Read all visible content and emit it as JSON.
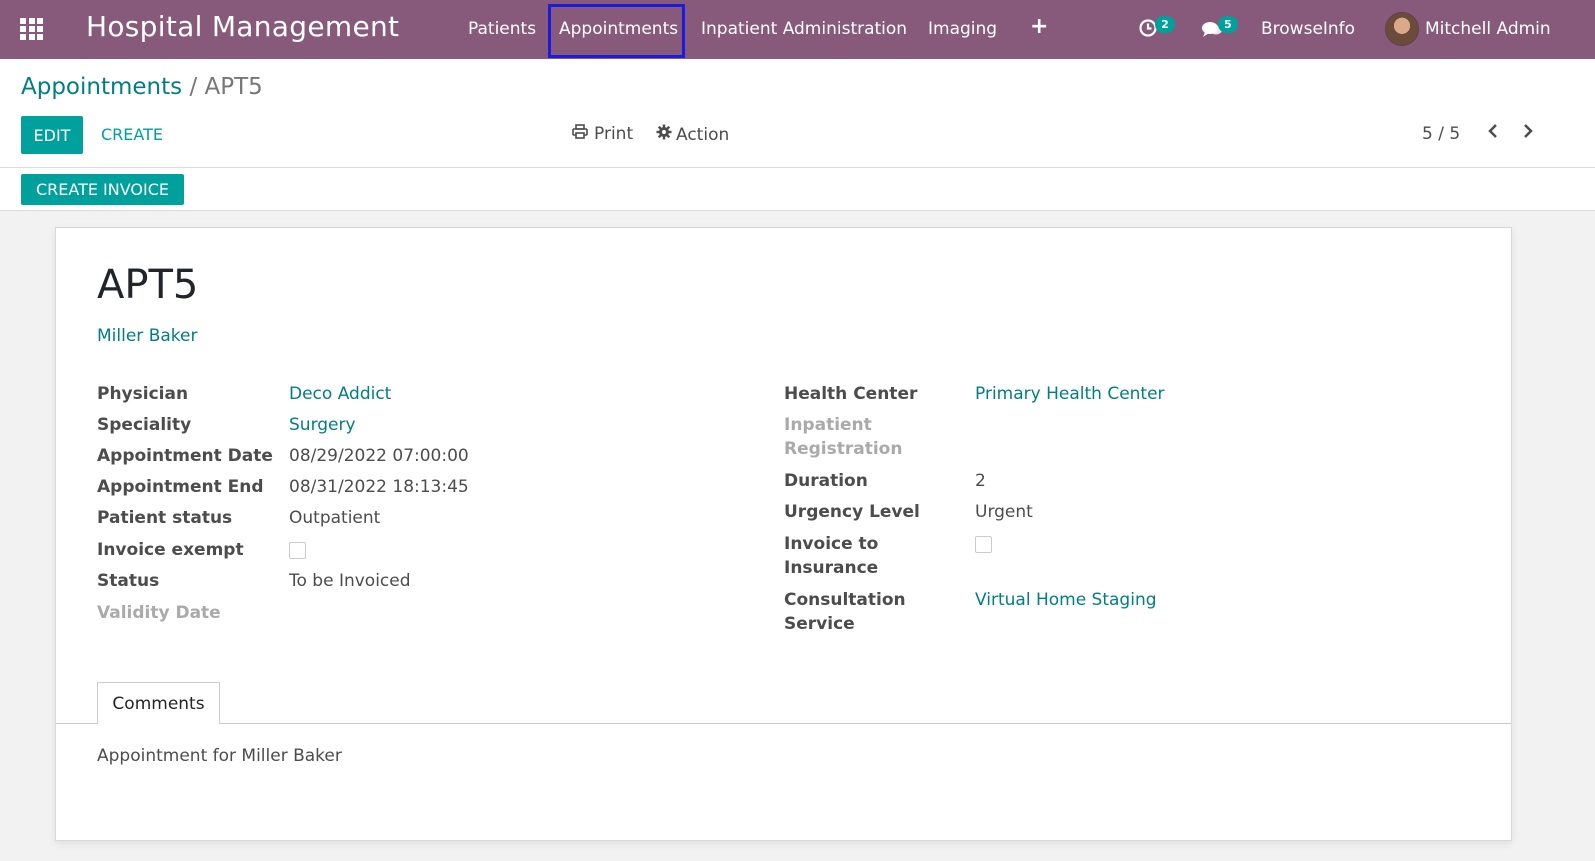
{
  "navbar": {
    "brand": "Hospital Management",
    "menu": [
      "Patients",
      "Appointments",
      "Inpatient Administration",
      "Imaging"
    ],
    "activities_count": "2",
    "messages_count": "5",
    "company": "BrowseInfo",
    "user": "Mitchell Admin",
    "bg_color": "#875a7b"
  },
  "breadcrumb": {
    "parent": "Appointments",
    "separator": "/",
    "current": "APT5"
  },
  "toolbar": {
    "edit": "EDIT",
    "create": "CREATE",
    "print": "Print",
    "action": "Action",
    "pager": "5 / 5"
  },
  "statusbar": {
    "create_invoice": "CREATE INVOICE"
  },
  "record": {
    "name": "APT5",
    "patient": "Miller Baker",
    "left": {
      "physician_label": "Physician",
      "physician": "Deco Addict",
      "speciality_label": "Speciality",
      "speciality": "Surgery",
      "date_label": "Appointment Date",
      "date": "08/29/2022 07:00:00",
      "end_label": "Appointment End",
      "end": "08/31/2022 18:13:45",
      "patient_status_label": "Patient status",
      "patient_status": "Outpatient",
      "invoice_exempt_label": "Invoice exempt",
      "invoice_exempt": false,
      "status_label": "Status",
      "status": "To be Invoiced",
      "validity_label": "Validity Date"
    },
    "right": {
      "health_center_label": "Health Center",
      "health_center": "Primary Health Center",
      "inpatient_reg_label_1": "Inpatient",
      "inpatient_reg_label_2": "Registration",
      "duration_label": "Duration",
      "duration": "2",
      "urgency_label": "Urgency Level",
      "urgency": "Urgent",
      "invoice_insurance_label_1": "Invoice to",
      "invoice_insurance_label_2": "Insurance",
      "invoice_insurance": false,
      "consultation_label_1": "Consultation",
      "consultation_label_2": "Service",
      "consultation": "Virtual Home Staging"
    }
  },
  "tabs": {
    "comments": "Comments"
  },
  "comments": "Appointment for Miller Baker",
  "colors": {
    "accent": "#00a09d",
    "link": "#017e84",
    "highlight_box": "#1a1de0"
  }
}
